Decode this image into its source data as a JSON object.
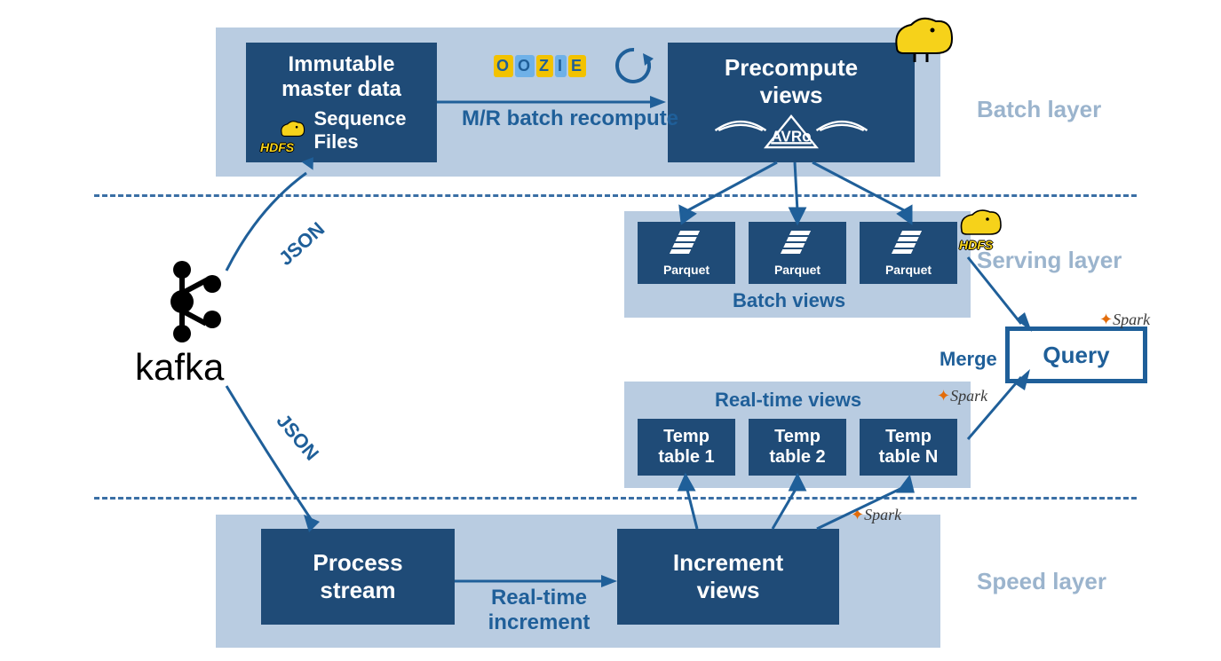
{
  "source": {
    "name": "kafka"
  },
  "edges": {
    "json_up": "JSON",
    "json_down": "JSON",
    "mr_batch": "M/R batch recompute",
    "realtime_inc": "Real-time increment",
    "merge": "Merge"
  },
  "batch": {
    "layer_label": "Batch layer",
    "master": {
      "title1": "Immutable",
      "title2": "master data",
      "hdfs": "HDFS",
      "seq1": "Sequence",
      "seq2": "Files"
    },
    "oozie": "OOZIE",
    "precompute": {
      "title1": "Precompute",
      "title2": "views",
      "logo": "AVRO"
    }
  },
  "serving": {
    "layer_label": "Serving layer",
    "batch_views_label": "Batch views",
    "parquet": [
      "Parquet",
      "Parquet",
      "Parquet"
    ],
    "hdfs": "HDFS",
    "realtime_views_label": "Real-time views",
    "temp": [
      "Temp table 1",
      "Temp table 2",
      "Temp table N"
    ],
    "spark1": "Spark",
    "spark2": "Spark"
  },
  "speed": {
    "layer_label": "Speed layer",
    "process": {
      "l1": "Process",
      "l2": "stream"
    },
    "increment": {
      "l1": "Increment",
      "l2": "views"
    },
    "spark": "Spark"
  },
  "query": {
    "label": "Query",
    "spark": "Spark"
  }
}
